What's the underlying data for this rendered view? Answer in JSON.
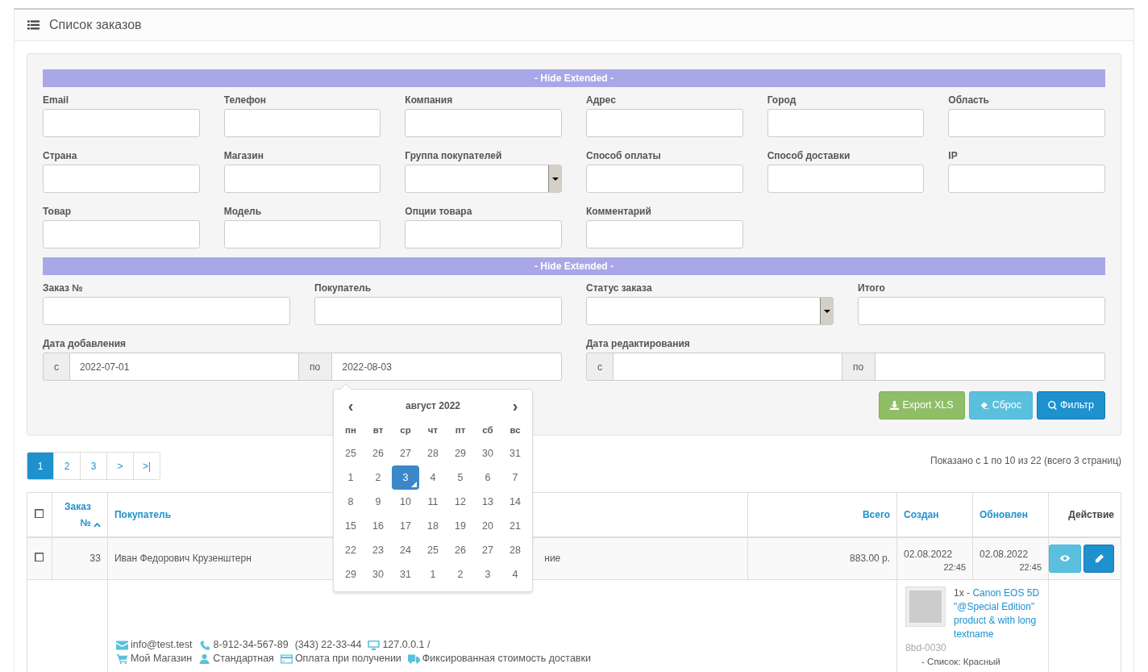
{
  "panel_title": "Список заказов",
  "filter": {
    "extended_toggles": [
      "- Hide Extended -",
      "- Hide Extended -"
    ],
    "extended_fields": [
      {
        "label": "Email",
        "kind": "text"
      },
      {
        "label": "Телефон",
        "kind": "text"
      },
      {
        "label": "Компания",
        "kind": "text"
      },
      {
        "label": "Адрес",
        "kind": "text"
      },
      {
        "label": "Город",
        "kind": "text"
      },
      {
        "label": "Область",
        "kind": "text"
      },
      {
        "label": "Страна",
        "kind": "text"
      },
      {
        "label": "Магазин",
        "kind": "text"
      },
      {
        "label": "Группа покупателей",
        "kind": "select"
      },
      {
        "label": "Способ оплаты",
        "kind": "text"
      },
      {
        "label": "Способ доставки",
        "kind": "text"
      },
      {
        "label": "IP",
        "kind": "text"
      },
      {
        "label": "Товар",
        "kind": "text"
      },
      {
        "label": "Модель",
        "kind": "text"
      },
      {
        "label": "Опции товара",
        "kind": "text"
      },
      {
        "label": "Комментарий",
        "kind": "text"
      }
    ],
    "main_fields": [
      {
        "label": "Заказ №",
        "kind": "text"
      },
      {
        "label": "Покупатель",
        "kind": "text"
      },
      {
        "label": "Статус заказа",
        "kind": "select"
      },
      {
        "label": "Итого",
        "kind": "text"
      }
    ],
    "date_ranges": [
      {
        "label": "Дата добавления",
        "from_prefix": "с",
        "from_value": "2022-07-01",
        "to_prefix": "по",
        "to_value": "2022-08-03"
      },
      {
        "label": "Дата редактирования",
        "from_prefix": "с",
        "to_prefix": "по"
      }
    ],
    "buttons": [
      {
        "label": "Export XLS",
        "kind": "export"
      },
      {
        "label": "Сброс",
        "kind": "reset"
      },
      {
        "label": "Фильтр",
        "kind": "filter"
      }
    ]
  },
  "datepicker": {
    "prev": "‹",
    "month_title": "август 2022",
    "next": "›",
    "weekdays": [
      "пн",
      "вт",
      "ср",
      "чт",
      "пт",
      "сб",
      "вс"
    ],
    "days": [
      {
        "day": "25",
        "selected": false
      },
      {
        "day": "26",
        "selected": false
      },
      {
        "day": "27",
        "selected": false
      },
      {
        "day": "28",
        "selected": false
      },
      {
        "day": "29",
        "selected": false
      },
      {
        "day": "30",
        "selected": false
      },
      {
        "day": "31",
        "selected": false
      },
      {
        "day": "1",
        "selected": false
      },
      {
        "day": "2",
        "selected": false
      },
      {
        "day": "3",
        "selected": true
      },
      {
        "day": "4",
        "selected": false
      },
      {
        "day": "5",
        "selected": false
      },
      {
        "day": "6",
        "selected": false
      },
      {
        "day": "7",
        "selected": false
      },
      {
        "day": "8",
        "selected": false
      },
      {
        "day": "9",
        "selected": false
      },
      {
        "day": "10",
        "selected": false
      },
      {
        "day": "11",
        "selected": false
      },
      {
        "day": "12",
        "selected": false
      },
      {
        "day": "13",
        "selected": false
      },
      {
        "day": "14",
        "selected": false
      },
      {
        "day": "15",
        "selected": false
      },
      {
        "day": "16",
        "selected": false
      },
      {
        "day": "17",
        "selected": false
      },
      {
        "day": "18",
        "selected": false
      },
      {
        "day": "19",
        "selected": false
      },
      {
        "day": "20",
        "selected": false
      },
      {
        "day": "21",
        "selected": false
      },
      {
        "day": "22",
        "selected": false
      },
      {
        "day": "23",
        "selected": false
      },
      {
        "day": "24",
        "selected": false
      },
      {
        "day": "25",
        "selected": false
      },
      {
        "day": "26",
        "selected": false
      },
      {
        "day": "27",
        "selected": false
      },
      {
        "day": "28",
        "selected": false
      },
      {
        "day": "29",
        "selected": false
      },
      {
        "day": "30",
        "selected": false
      },
      {
        "day": "31",
        "selected": false
      },
      {
        "day": "1",
        "selected": false
      },
      {
        "day": "2",
        "selected": false
      },
      {
        "day": "3",
        "selected": false
      },
      {
        "day": "4",
        "selected": false
      }
    ]
  },
  "pagination": [
    {
      "label": "1",
      "selected": true
    },
    {
      "label": "2",
      "selected": false
    },
    {
      "label": "3",
      "selected": false
    },
    {
      "label": ">",
      "selected": false
    },
    {
      "label": ">|",
      "selected": false
    }
  ],
  "summary": "Показано с 1 по 10 из 22 (всего 3 страниц)",
  "table": {
    "select_all_checked": false,
    "columns": [
      {
        "label": "Заказ №",
        "kind": "sorted"
      },
      {
        "label": "Покупатель",
        "kind": "link"
      },
      {
        "label": "Всего",
        "kind": "link"
      },
      {
        "label": "Создан",
        "kind": "link"
      },
      {
        "label": "Обновлен",
        "kind": "link"
      },
      {
        "label": "Действие",
        "kind": "plain"
      }
    ],
    "rows": [
      {
        "checked": false,
        "order_id": "33",
        "customer": "Иван Федорович Крузенштерн",
        "column_4": "ние",
        "total": "883.00 р.",
        "created_date": "02.08.2022",
        "created_time": "22:45",
        "updated_date": "02.08.2022",
        "updated_time": "22:45",
        "actions": [
          {
            "kind": "view"
          },
          {
            "kind": "edit"
          }
        ],
        "details": {
          "contacts": [
            {
              "kind": "email",
              "text": "info@test.test"
            },
            {
              "kind": "phone",
              "text": "8-912-34-567-89"
            },
            {
              "kind": "plain",
              "text": "(343) 22-33-44"
            },
            {
              "kind": "ip",
              "text": "127.0.0.1 /"
            }
          ],
          "order_info": [
            {
              "kind": "store",
              "text": "Мой Магазин"
            },
            {
              "kind": "group",
              "text": "Стандартная"
            },
            {
              "kind": "payment",
              "text": "Оплата при получении"
            },
            {
              "kind": "shipping",
              "text": "Фиксированная стоимость доставки"
            }
          ],
          "product": {
            "quantity": "1x -",
            "name": "Canon EOS 5D \"@Special Edition\" product & with long textname",
            "sku": "8bd-0030",
            "option": "- Список: Красный"
          }
        }
      }
    ]
  }
}
